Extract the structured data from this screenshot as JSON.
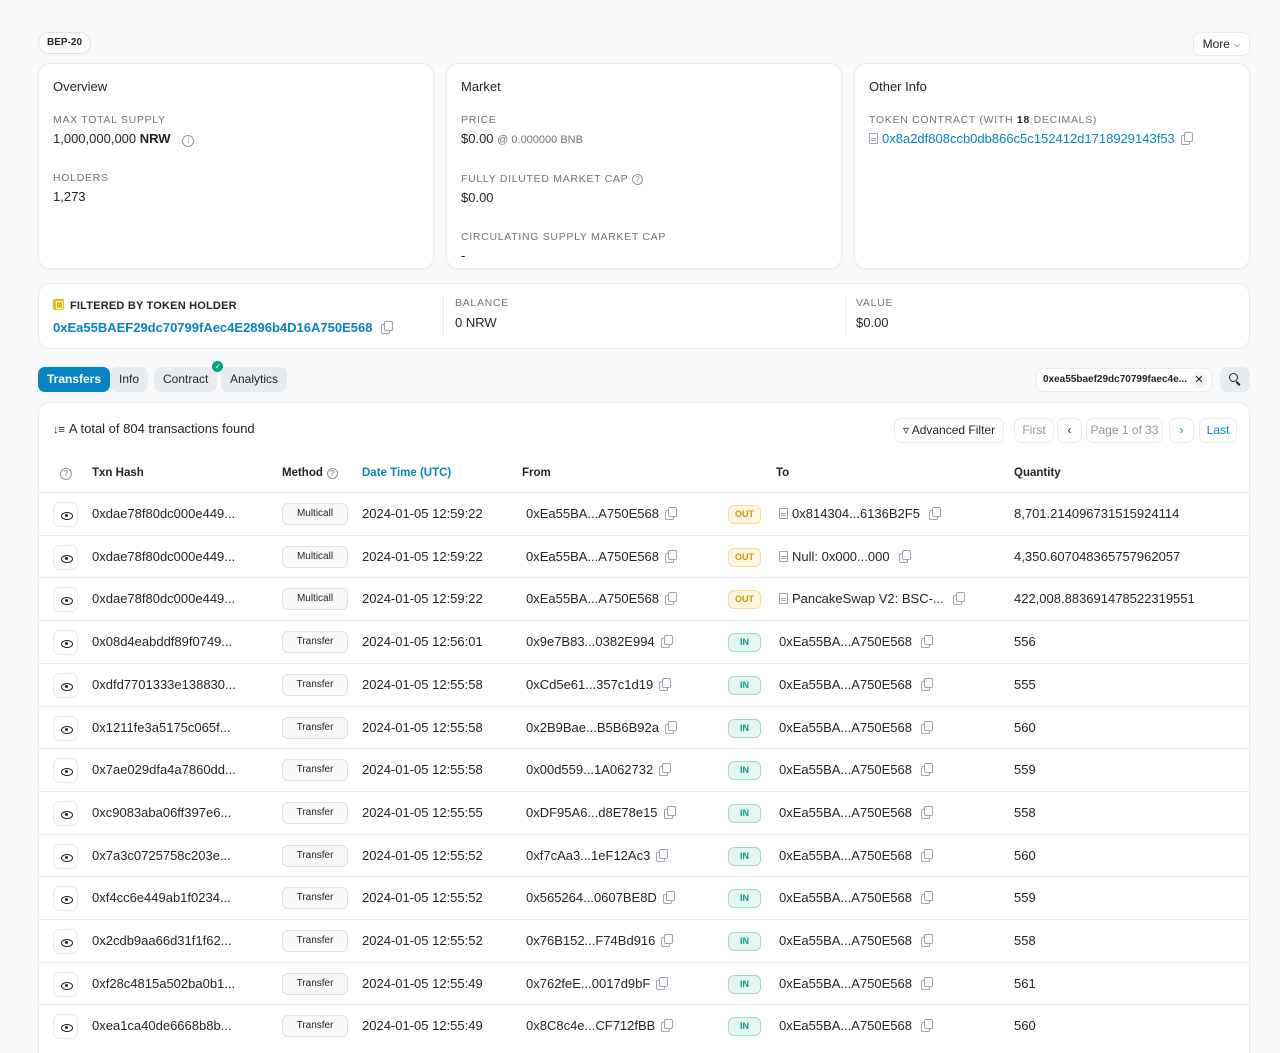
{
  "header": {
    "tag": "BEP-20",
    "more_label": "More"
  },
  "overview": {
    "title": "Overview",
    "max_supply_label": "MAX TOTAL SUPPLY",
    "max_supply_value": "1,000,000,000",
    "max_supply_unit": "NRW",
    "holders_label": "HOLDERS",
    "holders_value": "1,273"
  },
  "market": {
    "title": "Market",
    "price_label": "PRICE",
    "price_value": "$0.00",
    "price_sub": "@ 0.000000 BNB",
    "fdmc_label": "FULLY DILUTED MARKET CAP",
    "fdmc_value": "$0.00",
    "csmc_label": "CIRCULATING SUPPLY MARKET CAP",
    "csmc_value": "-"
  },
  "other_info": {
    "title": "Other Info",
    "contract_label_pre": "TOKEN CONTRACT (WITH ",
    "contract_decimals": "18",
    "contract_label_post": " DECIMALS)",
    "contract_address": "0x8a2df808ccb0db866c5c152412d1718929143f53"
  },
  "filter": {
    "title": "FILTERED BY TOKEN HOLDER",
    "address": "0xEa55BAEF29dc70799fAec4E2896b4D16A750E568",
    "balance_label": "BALANCE",
    "balance_value": "0 NRW",
    "value_label": "VALUE",
    "value_value": "$0.00"
  },
  "tabs": [
    {
      "label": "Transfers"
    },
    {
      "label": "Info"
    },
    {
      "label": "Contract"
    },
    {
      "label": "Analytics"
    }
  ],
  "search_chip": "0xea55baef29dc70799faec4e...",
  "table": {
    "summary": "A total of 804 transactions found",
    "advanced_filter": "Advanced Filter",
    "pager": {
      "first": "First",
      "page": "Page 1 of 33",
      "last": "Last"
    },
    "columns": {
      "txn_hash": "Txn Hash",
      "method": "Method",
      "datetime": "Date Time (UTC)",
      "from": "From",
      "to": "To",
      "quantity": "Quantity"
    },
    "rows": [
      {
        "hash": "0xdae78f80dc000e449...",
        "method": "Multicall",
        "time": "2024-01-05 12:59:22",
        "from": "0xEa55BA...A750E568",
        "dir": "OUT",
        "to": "0x814304...6136B2F5",
        "qty": "8,701.214096731515924114"
      },
      {
        "hash": "0xdae78f80dc000e449...",
        "method": "Multicall",
        "time": "2024-01-05 12:59:22",
        "from": "0xEa55BA...A750E568",
        "dir": "OUT",
        "to": "Null: 0x000...000",
        "qty": "4,350.607048365757962057"
      },
      {
        "hash": "0xdae78f80dc000e449...",
        "method": "Multicall",
        "time": "2024-01-05 12:59:22",
        "from": "0xEa55BA...A750E568",
        "dir": "OUT",
        "to": "PancakeSwap V2: BSC-...",
        "qty": "422,008.883691478522319551"
      },
      {
        "hash": "0x08d4eabddf89f0749...",
        "method": "Transfer",
        "time": "2024-01-05 12:56:01",
        "from": "0x9e7B83...0382E994",
        "dir": "IN",
        "to": "0xEa55BA...A750E568",
        "qty": "556"
      },
      {
        "hash": "0xdfd7701333e138830...",
        "method": "Transfer",
        "time": "2024-01-05 12:55:58",
        "from": "0xCd5e61...357c1d19",
        "dir": "IN",
        "to": "0xEa55BA...A750E568",
        "qty": "555"
      },
      {
        "hash": "0x1211fe3a5175c065f...",
        "method": "Transfer",
        "time": "2024-01-05 12:55:58",
        "from": "0x2B9Bae...B5B6B92a",
        "dir": "IN",
        "to": "0xEa55BA...A750E568",
        "qty": "560"
      },
      {
        "hash": "0x7ae029dfa4a7860dd...",
        "method": "Transfer",
        "time": "2024-01-05 12:55:58",
        "from": "0x00d559...1A062732",
        "dir": "IN",
        "to": "0xEa55BA...A750E568",
        "qty": "559"
      },
      {
        "hash": "0xc9083aba06ff397e6...",
        "method": "Transfer",
        "time": "2024-01-05 12:55:55",
        "from": "0xDF95A6...d8E78e15",
        "dir": "IN",
        "to": "0xEa55BA...A750E568",
        "qty": "558"
      },
      {
        "hash": "0x7a3c0725758c203e...",
        "method": "Transfer",
        "time": "2024-01-05 12:55:52",
        "from": "0xf7cAa3...1eF12Ac3",
        "dir": "IN",
        "to": "0xEa55BA...A750E568",
        "qty": "560"
      },
      {
        "hash": "0xf4cc6e449ab1f0234...",
        "method": "Transfer",
        "time": "2024-01-05 12:55:52",
        "from": "0x565264...0607BE8D",
        "dir": "IN",
        "to": "0xEa55BA...A750E568",
        "qty": "559"
      },
      {
        "hash": "0x2cdb9aa66d31f1f62...",
        "method": "Transfer",
        "time": "2024-01-05 12:55:52",
        "from": "0x76B152...F74Bd916",
        "dir": "IN",
        "to": "0xEa55BA...A750E568",
        "qty": "558"
      },
      {
        "hash": "0xf28c4815a502ba0b1...",
        "method": "Transfer",
        "time": "2024-01-05 12:55:49",
        "from": "0x762feE...0017d9bF",
        "dir": "IN",
        "to": "0xEa55BA...A750E568",
        "qty": "561"
      },
      {
        "hash": "0xea1ca40de6668b8b...",
        "method": "Transfer",
        "time": "2024-01-05 12:55:49",
        "from": "0x8C8c4e...CF712fBB",
        "dir": "IN",
        "to": "0xEa55BA...A750E568",
        "qty": "560"
      }
    ]
  },
  "colors": {
    "link": "#0784c3",
    "out_badge": "#cc9a06",
    "in_badge": "#00a186",
    "holder_badge": "#f0b90b"
  }
}
